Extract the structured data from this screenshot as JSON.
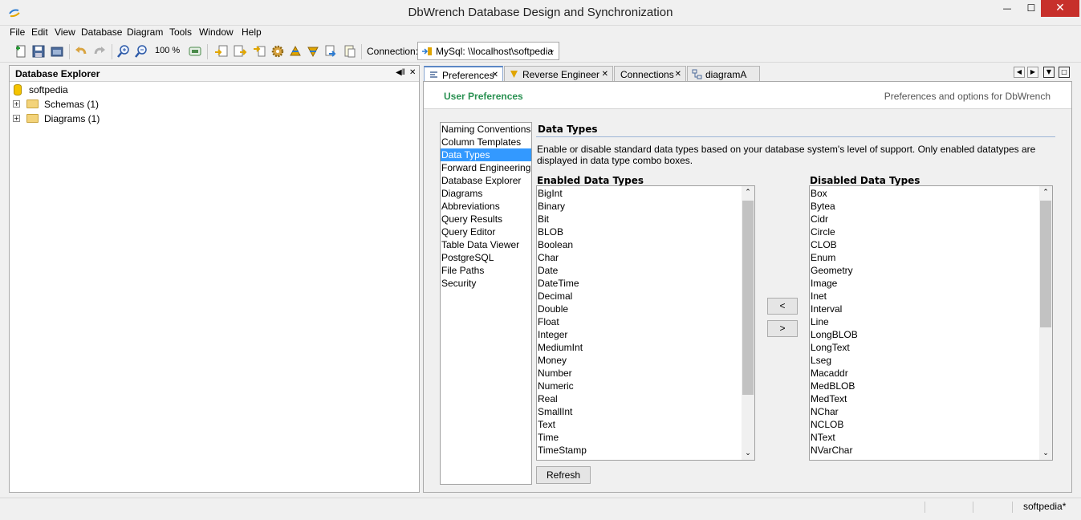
{
  "window": {
    "title": "DbWrench Database Design and Synchronization",
    "close_glyph": "✕",
    "min_glyph": "—",
    "max_glyph": "☐"
  },
  "menu": [
    "File",
    "Edit",
    "View",
    "Database",
    "Diagram",
    "Tools",
    "Window",
    "Help"
  ],
  "toolbar": {
    "zoom": "100 %",
    "connection_label": "Connection:",
    "connection_value": "MySql: \\\\localhost\\softpedia",
    "icons": [
      "new-icon",
      "save-icon",
      "open-icon",
      "undo-icon",
      "redo-icon",
      "zoom-in-icon",
      "zoom-out-icon",
      "zoom-value-icon",
      "import-icon",
      "export-icon",
      "sync-icon",
      "settings-icon",
      "forward-engineer-icon",
      "reverse-engineer-icon",
      "compare-icon",
      "script-icon"
    ]
  },
  "explorer": {
    "title": "Database Explorer",
    "root": "softpedia",
    "nodes": [
      "Schemas (1)",
      "Diagrams (1)"
    ]
  },
  "tabs": [
    {
      "label": "Preferences",
      "active": true
    },
    {
      "label": "Reverse Engineer",
      "active": false
    },
    {
      "label": "Connections",
      "active": false
    },
    {
      "label": "diagramA",
      "active": false
    }
  ],
  "preferences": {
    "title": "User Preferences",
    "subtitle": "Preferences and options for DbWrench",
    "nav": [
      "Naming Conventions",
      "Column Templates",
      "Data Types",
      "Forward Engineering",
      "Database Explorer",
      "Diagrams",
      "Abbreviations",
      "Query Results",
      "Query Editor",
      "Table Data Viewer",
      "PostgreSQL",
      "File Paths",
      "Security"
    ],
    "nav_selected": "Data Types",
    "section_title": "Data Types",
    "description": "Enable or disable standard data types based on your database system's level of support. Only enabled datatypes are displayed in data type combo boxes.",
    "enabled_label": "Enabled Data Types",
    "disabled_label": "Disabled Data Types",
    "enabled": [
      "BigInt",
      "Binary",
      "Bit",
      "BLOB",
      "Boolean",
      "Char",
      "Date",
      "DateTime",
      "Decimal",
      "Double",
      "Float",
      "Integer",
      "MediumInt",
      "Money",
      "Number",
      "Numeric",
      "Real",
      "SmallInt",
      "Text",
      "Time",
      "TimeStamp"
    ],
    "disabled": [
      "Box",
      "Bytea",
      "Cidr",
      "Circle",
      "CLOB",
      "Enum",
      "Geometry",
      "Image",
      "Inet",
      "Interval",
      "Line",
      "LongBLOB",
      "LongText",
      "Lseg",
      "Macaddr",
      "MedBLOB",
      "MedText",
      "NChar",
      "NCLOB",
      "NText",
      "NVarChar"
    ],
    "move_left": "<",
    "move_right": ">",
    "refresh": "Refresh"
  },
  "status": {
    "text": "softpedia*"
  }
}
